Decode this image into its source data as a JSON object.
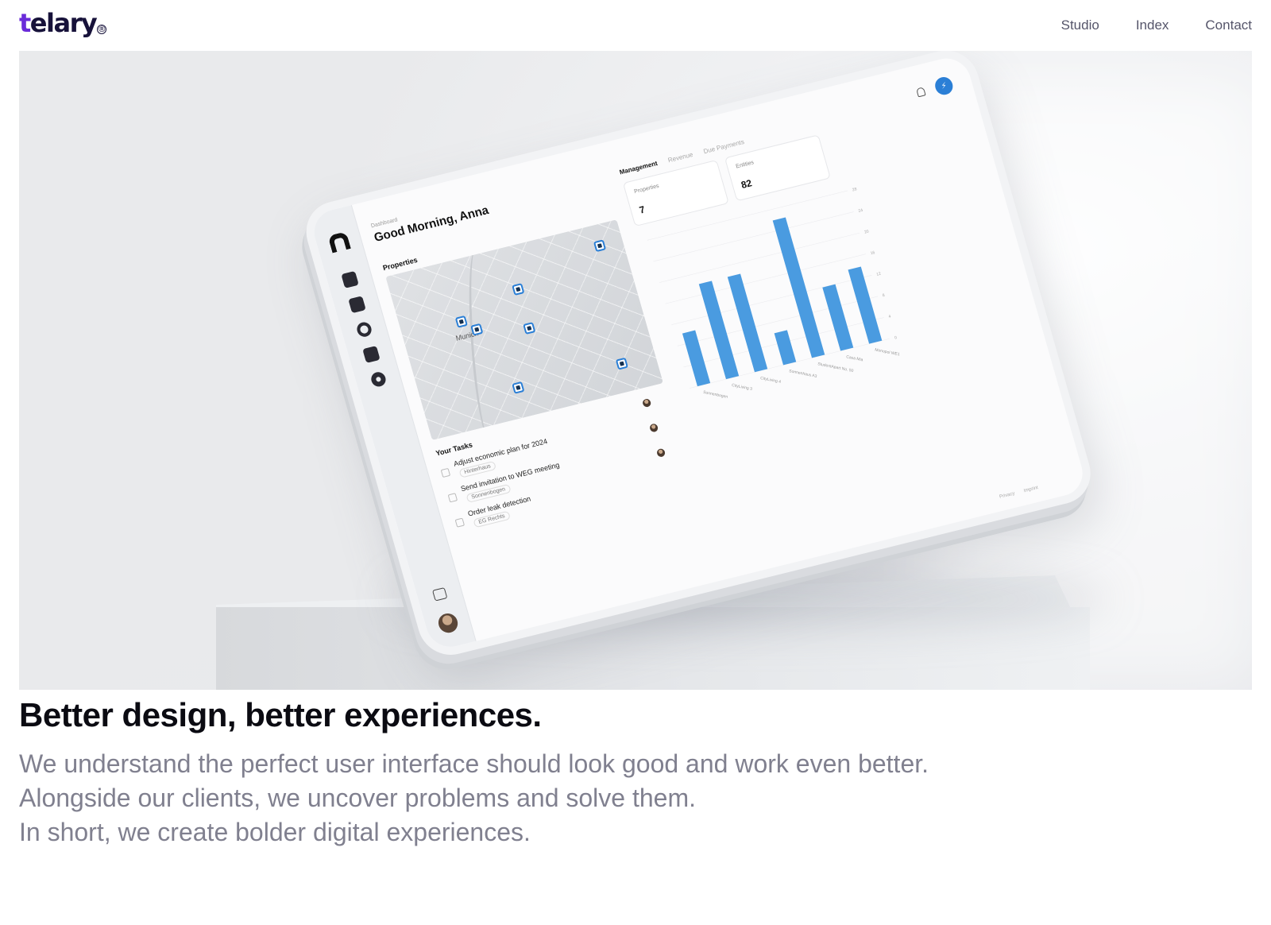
{
  "brand": {
    "logo_text": "telary",
    "logo_first": "t",
    "logo_rest": "elary",
    "logo_mark": "®",
    "logo_accent": "#6a2bd9",
    "logo_color": "#17123a"
  },
  "nav": {
    "items": [
      "Studio",
      "Index",
      "Contact"
    ]
  },
  "hero": {
    "dashboard": {
      "breadcrumb": "Dashboard",
      "greeting": "Good Morning, Anna",
      "properties_title": "Properties",
      "map_city": "Munich",
      "tabs": [
        "Management",
        "Revenue",
        "Due Payments"
      ],
      "cards": [
        {
          "label": "Properties",
          "value": "7"
        },
        {
          "label": "Entities",
          "value": "82"
        }
      ],
      "tasks_title": "Your Tasks",
      "tasks": [
        {
          "title": "Adjust economic plan for 2024",
          "tag": "Hinterhaus"
        },
        {
          "title": "Send invitation to WEG meeting",
          "tag": "Sonnenbogen"
        },
        {
          "title": "Order leak detection",
          "tag": "EG Rechts"
        }
      ],
      "footer": [
        "Privacy",
        "Imprint"
      ],
      "accent": "#2b7fd6"
    }
  },
  "chart_data": {
    "type": "bar",
    "categories": [
      "Sonnenbogen",
      "CityLiving 3",
      "CityLiving 4",
      "Sonnenhaus A3",
      "StudentApart No. 50",
      "Casa Mia",
      "Monopol WE1"
    ],
    "values": [
      10,
      18,
      18,
      6,
      26,
      12,
      14
    ],
    "ylabel": "",
    "ylim": [
      0,
      28
    ],
    "yticks": [
      "0",
      "4",
      "8",
      "12",
      "16",
      "20",
      "24",
      "28"
    ],
    "color": "#4a9be0"
  },
  "copy": {
    "headline": "Better design, better experiences.",
    "lines": [
      "We understand the perfect user interface should look good and work even better.",
      "Alongside our clients, we uncover problems and solve them.",
      "In short, we create bolder digital experiences."
    ]
  }
}
